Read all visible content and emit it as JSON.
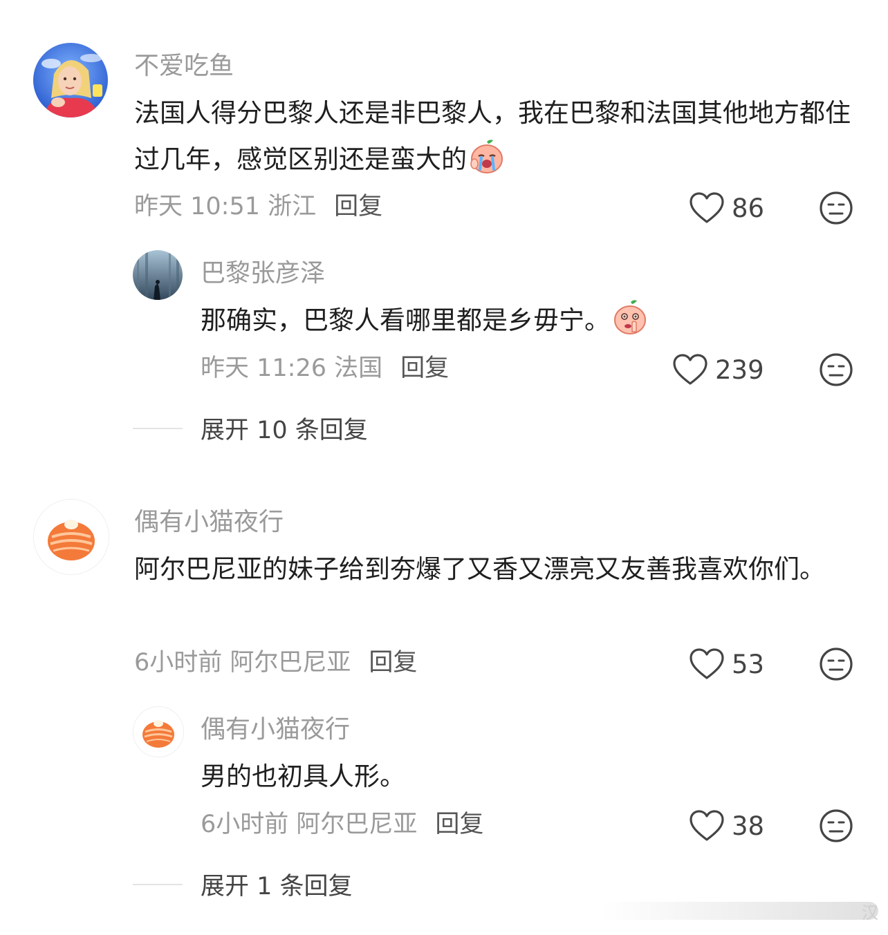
{
  "comments": [
    {
      "username": "不爱吃鱼",
      "content": "法国人得分巴黎人还是非巴黎人，我在巴黎和法国其他地方都住过几年，感觉区别还是蛮大的",
      "emoji": "crying-peach-emoji",
      "time_location": "昨天 10:51 浙江",
      "reply_label": "回复",
      "likes": "86",
      "avatar": "blonde-girl-avatar",
      "replies": [
        {
          "username": "巴黎张彦泽",
          "content": "那确实，巴黎人看哪里都是乡毋宁。",
          "emoji": "picking-nose-peach-emoji",
          "time_location": "昨天 11:26 法国",
          "reply_label": "回复",
          "likes": "239",
          "avatar": "misty-forest-avatar"
        }
      ],
      "expand_label": "展开 10 条回复"
    },
    {
      "username": "偶有小猫夜行",
      "content": "阿尔巴尼亚的妹子给到夯爆了又香又漂亮又友善我喜欢你们。",
      "time_location": "6小时前 阿尔巴尼亚",
      "reply_label": "回复",
      "likes": "53",
      "avatar": "salmon-sushi-avatar",
      "replies": [
        {
          "username": "偶有小猫夜行",
          "content": "男的也初具人形。",
          "time_location": "6小时前 阿尔巴尼亚",
          "reply_label": "回复",
          "likes": "38",
          "avatar": "salmon-sushi-avatar"
        }
      ],
      "expand_label": "展开 1 条回复"
    }
  ],
  "watermark_char": "汉"
}
